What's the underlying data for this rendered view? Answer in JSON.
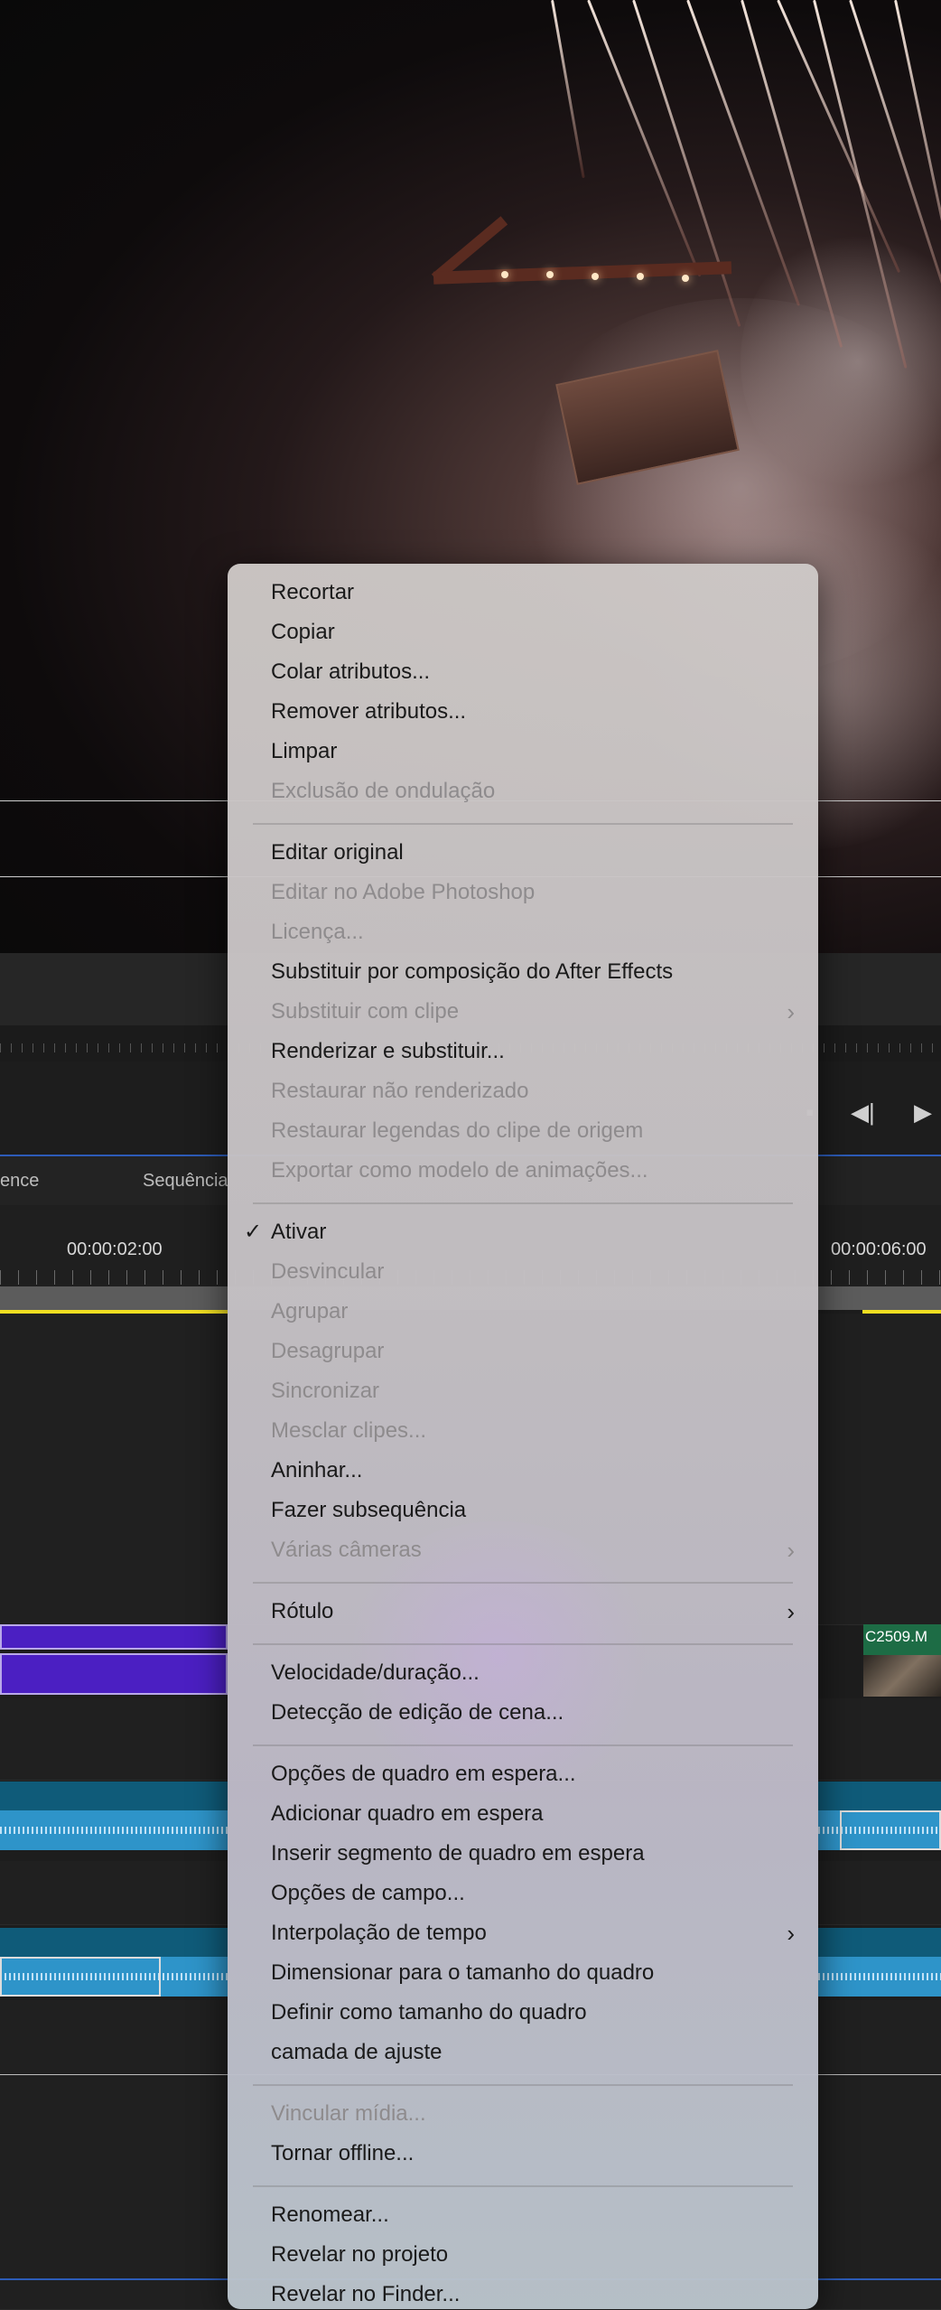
{
  "timeline": {
    "tabs": [
      "ence",
      "Sequência"
    ],
    "timecodes": [
      "00:00:02:00",
      "00:00:06:00"
    ],
    "clip_label": "C2509.M"
  },
  "colors": {
    "menu_text": "#1a1a1a",
    "menu_disabled": "#8e8b8d",
    "clip_purple": "#4b1fc2",
    "clip_green": "#1d6c45",
    "audio_blue": "#2e94c9",
    "playhead_yellow": "#f1df22"
  },
  "context_menu": {
    "groups": [
      [
        {
          "label": "Recortar",
          "enabled": true
        },
        {
          "label": "Copiar",
          "enabled": true
        },
        {
          "label": "Colar atributos...",
          "enabled": true
        },
        {
          "label": "Remover atributos...",
          "enabled": true
        },
        {
          "label": "Limpar",
          "enabled": true
        },
        {
          "label": "Exclusão de ondulação",
          "enabled": false
        }
      ],
      [
        {
          "label": "Editar original",
          "enabled": true
        },
        {
          "label": "Editar no Adobe Photoshop",
          "enabled": false
        },
        {
          "label": "Licença...",
          "enabled": false
        },
        {
          "label": "Substituir por composição do After Effects",
          "enabled": true
        },
        {
          "label": "Substituir com clipe",
          "enabled": false,
          "submenu": true
        },
        {
          "label": "Renderizar e substituir...",
          "enabled": true
        },
        {
          "label": "Restaurar não renderizado",
          "enabled": false
        },
        {
          "label": "Restaurar legendas do clipe de origem",
          "enabled": false
        },
        {
          "label": "Exportar como modelo de animações...",
          "enabled": false
        }
      ],
      [
        {
          "label": "Ativar",
          "enabled": true,
          "checked": true
        },
        {
          "label": "Desvincular",
          "enabled": false
        },
        {
          "label": "Agrupar",
          "enabled": false
        },
        {
          "label": "Desagrupar",
          "enabled": false
        },
        {
          "label": "Sincronizar",
          "enabled": false
        },
        {
          "label": "Mesclar clipes...",
          "enabled": false
        },
        {
          "label": "Aninhar...",
          "enabled": true
        },
        {
          "label": "Fazer subsequência",
          "enabled": true
        },
        {
          "label": "Várias câmeras",
          "enabled": false,
          "submenu": true
        }
      ],
      [
        {
          "label": "Rótulo",
          "enabled": true,
          "submenu": true
        }
      ],
      [
        {
          "label": "Velocidade/duração...",
          "enabled": true
        },
        {
          "label": "Detecção de edição de cena...",
          "enabled": true
        }
      ],
      [
        {
          "label": "Opções de quadro em espera...",
          "enabled": true
        },
        {
          "label": "Adicionar quadro em espera",
          "enabled": true
        },
        {
          "label": "Inserir segmento de quadro em espera",
          "enabled": true
        },
        {
          "label": "Opções de campo...",
          "enabled": true
        },
        {
          "label": "Interpolação de tempo",
          "enabled": true,
          "submenu": true
        },
        {
          "label": "Dimensionar para o tamanho do quadro",
          "enabled": true
        },
        {
          "label": "Definir como tamanho do quadro",
          "enabled": true
        },
        {
          "label": "camada de ajuste",
          "enabled": true
        }
      ],
      [
        {
          "label": "Vincular mídia...",
          "enabled": false
        },
        {
          "label": "Tornar offline...",
          "enabled": true
        }
      ],
      [
        {
          "label": "Renomear...",
          "enabled": true
        },
        {
          "label": "Revelar no projeto",
          "enabled": true
        },
        {
          "label": "Revelar no Finder...",
          "enabled": true
        }
      ]
    ]
  }
}
